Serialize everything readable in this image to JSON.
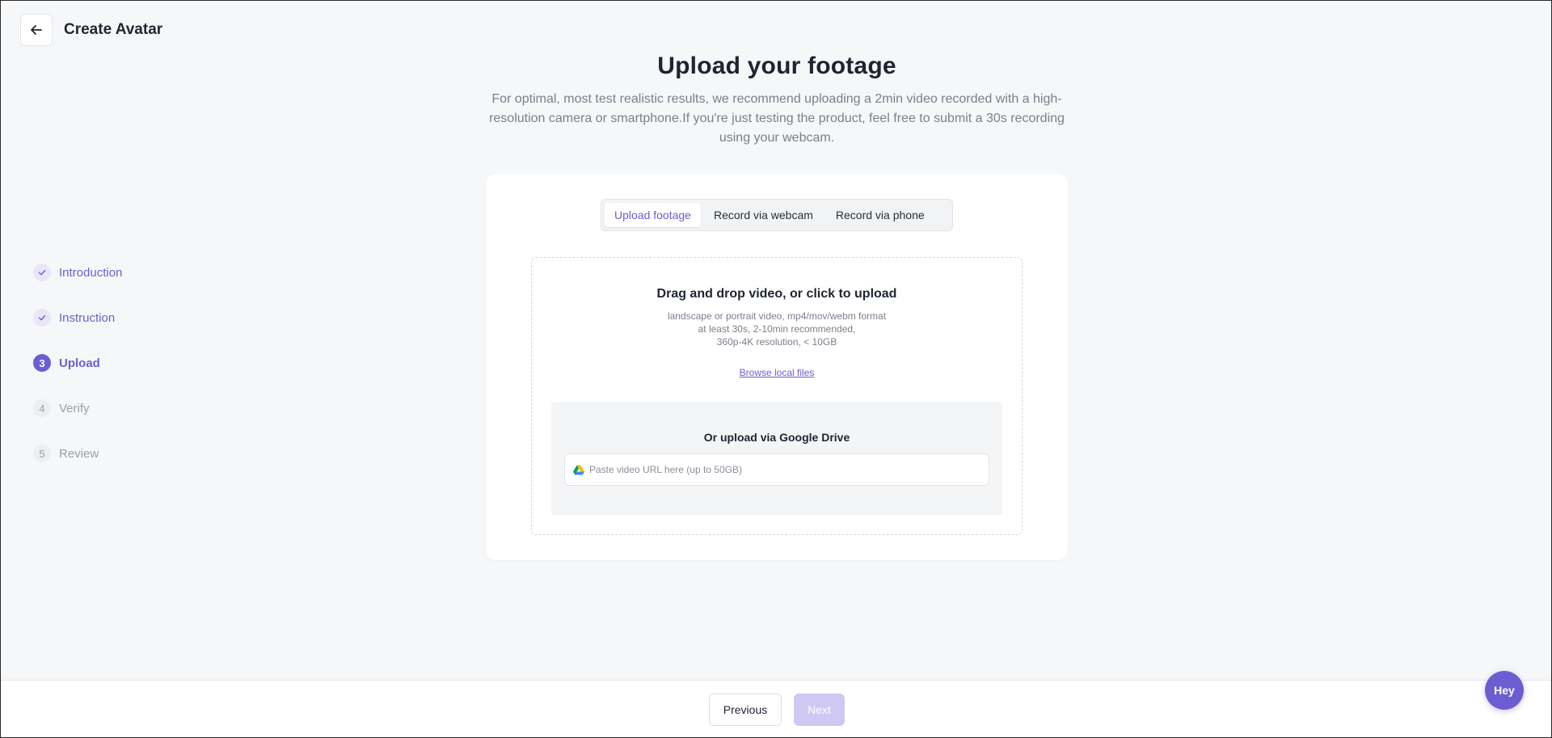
{
  "header": {
    "title": "Create Avatar",
    "back_icon": "arrow-left-icon"
  },
  "main": {
    "heading": "Upload your footage",
    "description": "For optimal, most test realistic results, we recommend uploading a 2min video recorded with a high-resolution camera or smartphone.If you're just testing the product, feel free to submit a 30s recording using your webcam."
  },
  "steps": [
    {
      "label": "Introduction",
      "marker": "",
      "state": "done"
    },
    {
      "label": "Instruction",
      "marker": "",
      "state": "done"
    },
    {
      "label": "Upload",
      "marker": "3",
      "state": "active"
    },
    {
      "label": "Verify",
      "marker": "4",
      "state": "todo"
    },
    {
      "label": "Review",
      "marker": "5",
      "state": "todo"
    }
  ],
  "tabs": [
    {
      "label": "Upload footage",
      "active": true
    },
    {
      "label": "Record via webcam",
      "active": false
    },
    {
      "label": "Record via phone",
      "active": false
    }
  ],
  "upload": {
    "title": "Drag and drop video, or click to upload",
    "desc_lines": [
      "landscape or portrait video, mp4/mov/webm format",
      "at least 30s, 2-10min recommended,",
      "360p-4K resolution, < 10GB"
    ],
    "browse_label": "Browse local files"
  },
  "gdrive": {
    "title": "Or upload via Google Drive",
    "placeholder": "Paste video URL here (up to 50GB)",
    "value": "",
    "icon": "google-drive-icon"
  },
  "footer": {
    "previous_label": "Previous",
    "next_label": "Next"
  },
  "chat": {
    "label": "Hey"
  },
  "colors": {
    "accent": "#6d5dd3",
    "accent_light": "#e9e6f7",
    "next_disabled": "#cfc8f3",
    "background": "#f6f7f9"
  }
}
